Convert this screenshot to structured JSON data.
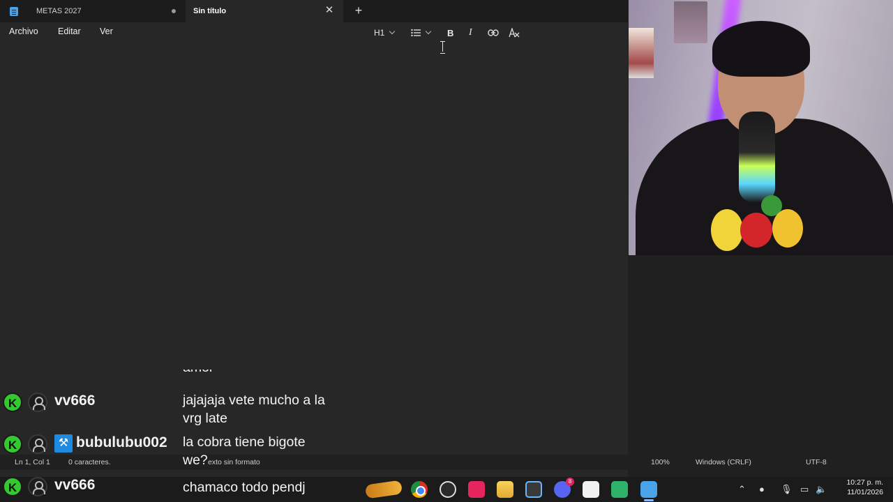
{
  "tabs": [
    {
      "label": "METAS 2027",
      "unsaved": true
    },
    {
      "label": "Sin título",
      "active": true
    }
  ],
  "menu": [
    "Archivo",
    "Editar",
    "Ver"
  ],
  "toolbar": {
    "heading": "H1",
    "bold": "B",
    "italic": "I"
  },
  "statusbar": {
    "position": "Ln 1, Col 1",
    "chars": "0 caracteres.",
    "format": "exto sin formato",
    "zoom": "100%",
    "eol": "Windows (CRLF)",
    "encoding": "UTF-8"
  },
  "chat": {
    "cut_text": "amor",
    "rows": [
      {
        "user": "vv666",
        "message_lines": [
          "jajajaja vete mucho a la",
          "vrg late"
        ]
      },
      {
        "user": "bubulubu002",
        "message_lines": [
          "la cobra tiene bigote",
          "we?"
        ]
      },
      {
        "user": "vv666",
        "message_lines": [
          "chamaco todo pendj"
        ]
      }
    ]
  },
  "taskbar": {
    "discord_badge": "8",
    "time": "10:27 p. m.",
    "date": "11/01/2026"
  },
  "colors": {
    "editor_bg": "#272727",
    "tabbar_bg": "#1c1c1c",
    "kick_green": "#34c930",
    "accent_blue": "#4aa3e8"
  }
}
